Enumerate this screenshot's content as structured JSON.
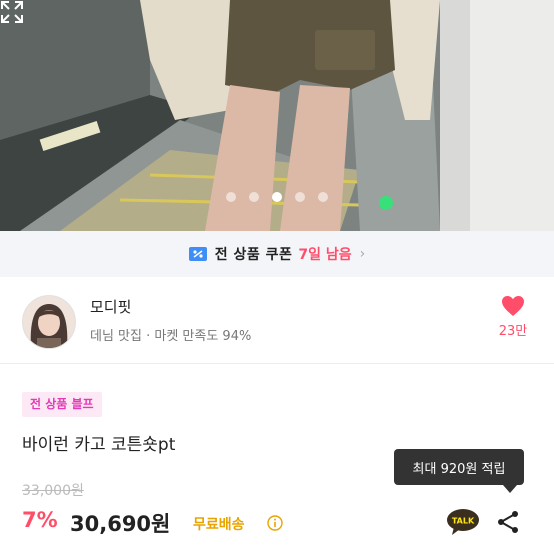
{
  "gallery": {
    "total_images": 5,
    "active_index": 2
  },
  "coupon": {
    "label": "전 상품 쿠폰",
    "remaining": "7일 남음",
    "accent_color": "#ff4d6a"
  },
  "shop": {
    "name": "모디핏",
    "description": "데님 맛집 · 마켓 만족도 94%",
    "likes": "23만"
  },
  "product": {
    "badge": "전 상품 블프",
    "title": "바이런 카고 코튼숏pt",
    "original_price": "33,000원",
    "discount": "7%",
    "price": "30,690원",
    "shipping": "무료배송"
  },
  "tooltip": {
    "text": "최대 920원 적립"
  },
  "actions": {
    "talk_label": "TALK"
  },
  "icons": [
    "expand-icon",
    "coupon-icon",
    "chevron-right-icon",
    "heart-icon",
    "info-icon",
    "kakao-talk-icon",
    "share-icon"
  ]
}
